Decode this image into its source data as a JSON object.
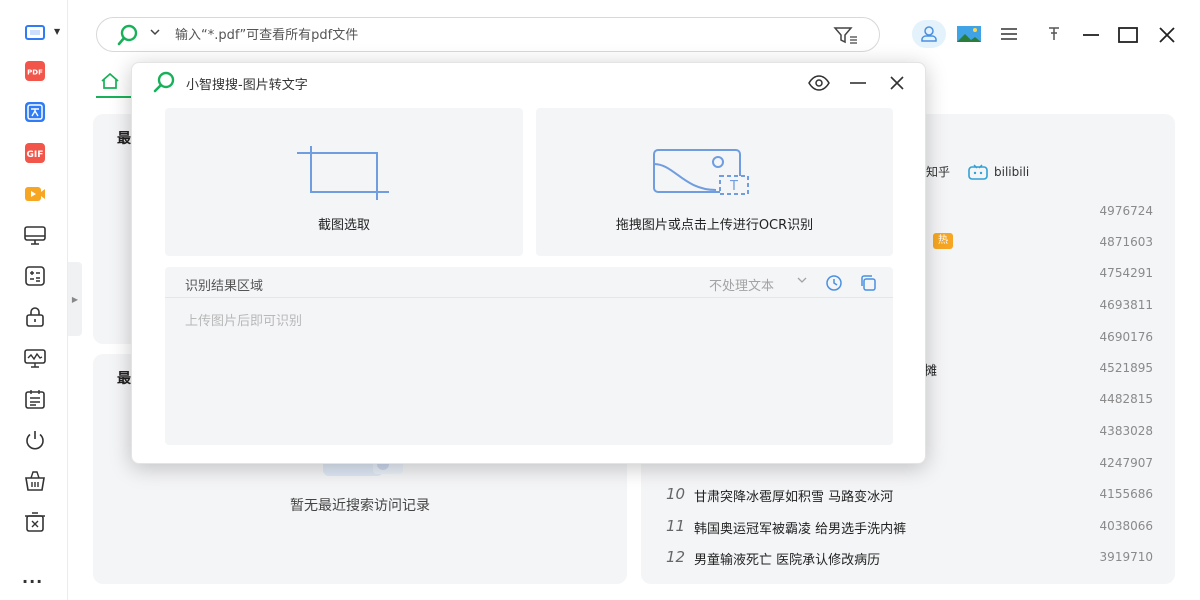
{
  "search": {
    "placeholder": "输入“*.pdf”可查看所有pdf文件"
  },
  "sidebar": {
    "items": [
      {
        "name": "screenshot",
        "icon": "screen-capture-icon"
      },
      {
        "name": "pdf",
        "icon": "pdf-icon",
        "badge": "PDF"
      },
      {
        "name": "translate",
        "icon": "translate-icon",
        "badge": "文"
      },
      {
        "name": "gif",
        "icon": "gif-icon",
        "badge": "GIF"
      },
      {
        "name": "video",
        "icon": "video-icon"
      },
      {
        "name": "monitor",
        "icon": "monitor-icon"
      },
      {
        "name": "calculator",
        "icon": "calculator-icon"
      },
      {
        "name": "lock",
        "icon": "lock-icon"
      },
      {
        "name": "monitor-wave",
        "icon": "system-monitor-icon"
      },
      {
        "name": "calendar",
        "icon": "calendar-icon"
      },
      {
        "name": "power",
        "icon": "power-icon"
      },
      {
        "name": "basket",
        "icon": "cleanup-basket-icon"
      },
      {
        "name": "trash",
        "icon": "trash-icon"
      }
    ],
    "more": "..."
  },
  "panels": {
    "recent_title_1": "最",
    "recent_title_2": "最",
    "empty_text": "暂无最近搜索访问记录",
    "hot_sources": [
      "知乎",
      "bilibili"
    ],
    "hot_badge": "热",
    "hot_list": [
      {
        "rank": "",
        "title": "",
        "count": "4976724"
      },
      {
        "rank": "",
        "title": "",
        "count": "4871603"
      },
      {
        "rank": "",
        "title": "",
        "count": "4754291"
      },
      {
        "rank": "",
        "title": "",
        "count": "4693811"
      },
      {
        "rank": "",
        "title": "",
        "count": "4690176"
      },
      {
        "rank": "",
        "title": "摊",
        "count": "4521895"
      },
      {
        "rank": "",
        "title": "",
        "count": "4482815"
      },
      {
        "rank": "",
        "title": "",
        "count": "4383028"
      },
      {
        "rank": "",
        "title": "",
        "count": "4247907"
      },
      {
        "rank": "10",
        "title": "甘肃突降冰雹厚如积雪 马路变冰河",
        "count": "4155686"
      },
      {
        "rank": "11",
        "title": "韩国奥运冠军被霸凌 给男选手洗内裤",
        "count": "4038066"
      },
      {
        "rank": "12",
        "title": "男童输液死亡 医院承认修改病历",
        "count": "3919710"
      }
    ]
  },
  "dialog": {
    "title": "小智搜搜-图片转文字",
    "crop_label": "截图选取",
    "upload_label": "拖拽图片或点击上传进行OCR识别",
    "result_title": "识别结果区域",
    "text_mode": "不处理文本",
    "result_placeholder": "上传图片后即可识别"
  },
  "colors": {
    "accent_green": "#18b15a",
    "icon_blue": "#4a90e2",
    "red": "#f2554a",
    "orange": "#f6a623"
  }
}
